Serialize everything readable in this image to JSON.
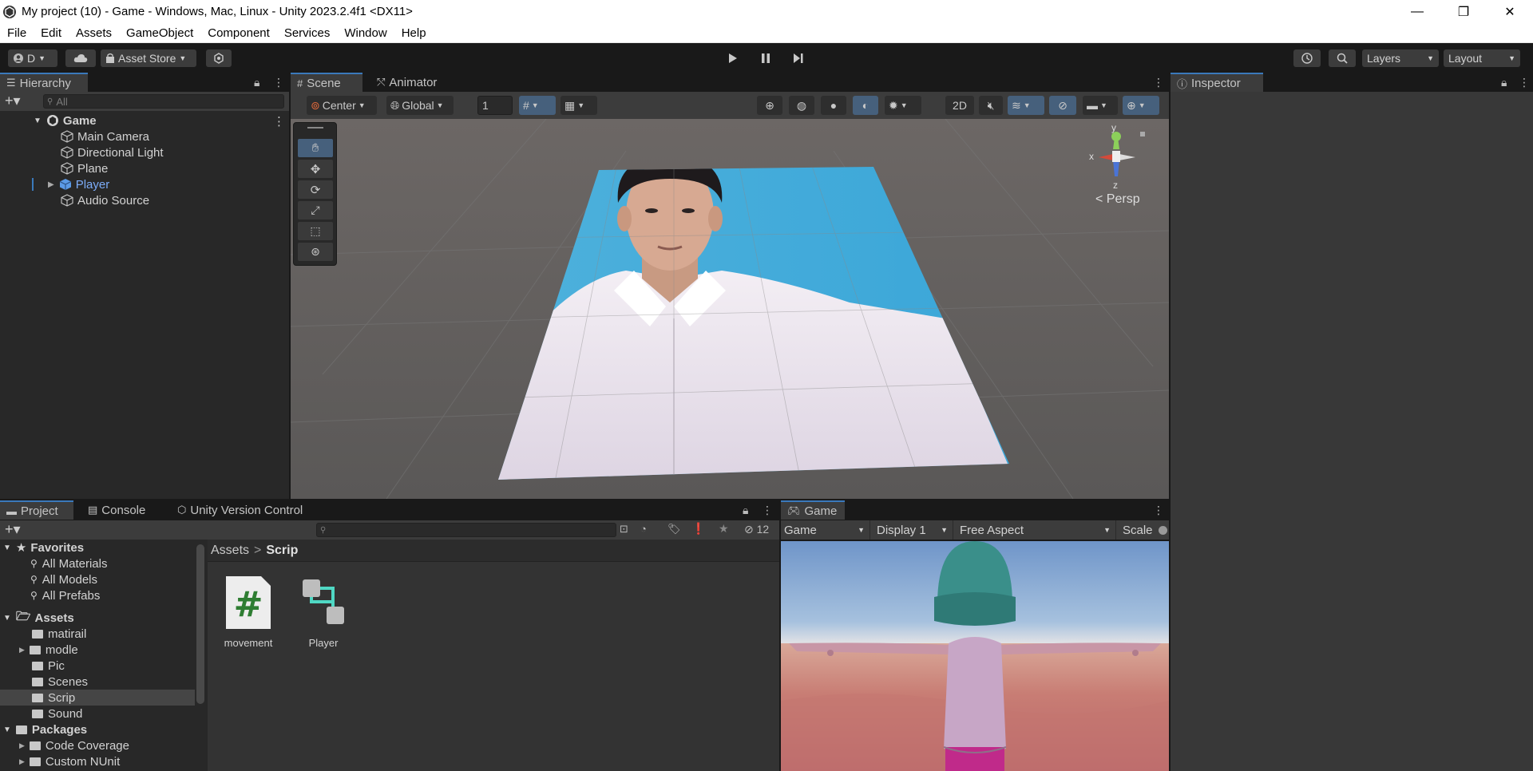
{
  "window": {
    "title": "My project (10) - Game - Windows, Mac, Linux - Unity 2023.2.4f1 <DX11>",
    "controls": [
      "—",
      "❐",
      "✕"
    ]
  },
  "menu": [
    "File",
    "Edit",
    "Assets",
    "GameObject",
    "Component",
    "Services",
    "Window",
    "Help"
  ],
  "toolbar": {
    "account_label": "D",
    "asset_store_label": "Asset Store",
    "layers_label": "Layers",
    "layout_label": "Layout"
  },
  "hierarchy": {
    "tab_label": "Hierarchy",
    "search_placeholder": "All",
    "scene_name": "Game",
    "items": [
      {
        "label": "Main Camera"
      },
      {
        "label": "Directional Light"
      },
      {
        "label": "Plane"
      },
      {
        "label": "Player"
      },
      {
        "label": "Audio Source"
      }
    ]
  },
  "scene": {
    "tabs": [
      "Scene",
      "Animator"
    ],
    "pivot_label": "Center",
    "space_label": "Global",
    "grid_value": "1",
    "mode_2d_label": "2D",
    "persp_label": "Persp",
    "axis_labels": {
      "x": "x",
      "y": "y",
      "z": "z"
    }
  },
  "inspector": {
    "tab_label": "Inspector"
  },
  "project": {
    "tabs": [
      "Project",
      "Console",
      "Unity Version Control"
    ],
    "hidden_count": "12",
    "breadcrumb": [
      "Assets",
      "Scrip"
    ],
    "favorites_label": "Favorites",
    "favorites": [
      "All Materials",
      "All Models",
      "All Prefabs"
    ],
    "assets_label": "Assets",
    "asset_folders": [
      "matirail",
      "modle",
      "Pic",
      "Scenes",
      "Scrip",
      "Sound"
    ],
    "packages_label": "Packages",
    "package_folders": [
      "Code Coverage",
      "Custom NUnit"
    ],
    "files": [
      {
        "name": "movement",
        "icon": "csharp-script-icon"
      },
      {
        "name": "Player",
        "icon": "prefab-icon"
      }
    ]
  },
  "game": {
    "tab_label": "Game",
    "view_dropdown": "Game",
    "display_dropdown": "Display 1",
    "aspect_dropdown": "Free Aspect",
    "scale_label": "Scale"
  },
  "colors": {
    "accent_blue": "#3a79bb",
    "selection_blue": "#7cacf8",
    "panel_bg": "#282828",
    "toolbar_bg": "#3c3c3c"
  }
}
